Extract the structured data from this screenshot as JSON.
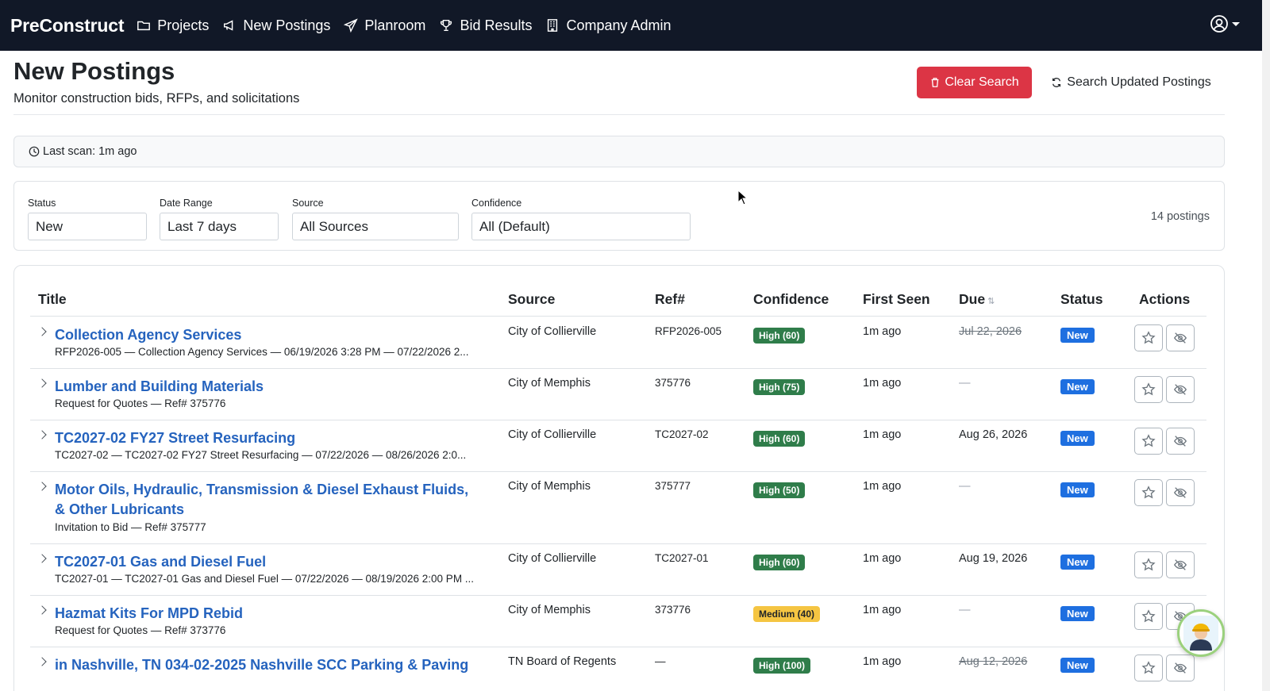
{
  "nav": {
    "brand": "PreConstruct",
    "items": [
      {
        "label": "Projects",
        "icon": "folder-icon"
      },
      {
        "label": "New Postings",
        "icon": "megaphone-icon"
      },
      {
        "label": "Planroom",
        "icon": "paper-plane-icon"
      },
      {
        "label": "Bid Results",
        "icon": "trophy-icon"
      },
      {
        "label": "Company Admin",
        "icon": "building-icon"
      }
    ],
    "user_icon": "user-circle-icon"
  },
  "header": {
    "title": "New Postings",
    "subtitle": "Monitor construction bids, RFPs, and solicitations",
    "clear_label": "Clear Search",
    "search_label": "Search Updated Postings"
  },
  "scan": {
    "text": "Last scan: 1m ago"
  },
  "filters": {
    "status": {
      "label": "Status",
      "value": "New"
    },
    "date_range": {
      "label": "Date Range",
      "value": "Last 7 days"
    },
    "source": {
      "label": "Source",
      "value": "All Sources"
    },
    "confidence": {
      "label": "Confidence",
      "value": "All (Default)"
    },
    "count": "14 postings"
  },
  "table": {
    "columns": {
      "title": "Title",
      "source": "Source",
      "ref": "Ref#",
      "confidence": "Confidence",
      "first_seen": "First Seen",
      "due": "Due",
      "status": "Status",
      "actions": "Actions"
    },
    "rows": [
      {
        "title": "Collection Agency Services",
        "sub": "RFP2026-005 — Collection Agency Services — 06/19/2026 3:28 PM — 07/22/2026 2...",
        "source": "City of Collierville",
        "ref": "RFP2026-005",
        "confidence": "High (60)",
        "level": "high",
        "seen": "1m ago",
        "due": "Jul 22, 2026",
        "due_style": "strike",
        "status": "New"
      },
      {
        "title": "Lumber and Building Materials",
        "sub": "Request for Quotes — Ref# 375776",
        "source": "City of Memphis",
        "ref": "375776",
        "confidence": "High (75)",
        "level": "high",
        "seen": "1m ago",
        "due": "—",
        "due_style": "dash",
        "status": "New"
      },
      {
        "title": "TC2027-02 FY27 Street Resurfacing",
        "sub": "TC2027-02 — TC2027-02 FY27 Street Resurfacing — 07/22/2026 — 08/26/2026 2:0...",
        "source": "City of Collierville",
        "ref": "TC2027-02",
        "confidence": "High (60)",
        "level": "high",
        "seen": "1m ago",
        "due": "Aug 26, 2026",
        "due_style": "normal",
        "status": "New"
      },
      {
        "title": "Motor Oils, Hydraulic, Transmission & Diesel Exhaust Fluids, & Other Lubricants",
        "sub": "Invitation to Bid — Ref# 375777",
        "source": "City of Memphis",
        "ref": "375777",
        "confidence": "High (50)",
        "level": "high",
        "seen": "1m ago",
        "due": "—",
        "due_style": "dash",
        "status": "New"
      },
      {
        "title": "TC2027-01 Gas and Diesel Fuel",
        "sub": "TC2027-01 — TC2027-01 Gas and Diesel Fuel — 07/22/2026 — 08/19/2026 2:00 PM ...",
        "source": "City of Collierville",
        "ref": "TC2027-01",
        "confidence": "High (60)",
        "level": "high",
        "seen": "1m ago",
        "due": "Aug 19, 2026",
        "due_style": "normal",
        "status": "New"
      },
      {
        "title": "Hazmat Kits For MPD Rebid",
        "sub": "Request for Quotes — Ref# 373776",
        "source": "City of Memphis",
        "ref": "373776",
        "confidence": "Medium (40)",
        "level": "medium",
        "seen": "1m ago",
        "due": "—",
        "due_style": "dash",
        "status": "New"
      },
      {
        "title": "in Nashville, TN 034-02-2025 Nashville SCC Parking & Paving",
        "sub": "",
        "source": "TN Board of Regents",
        "ref": "—",
        "confidence": "High (100)",
        "level": "high",
        "seen": "1m ago",
        "due": "Aug 12, 2026",
        "due_style": "strike",
        "status": "New"
      }
    ]
  },
  "colors": {
    "navbar": "#111827",
    "link": "#2563be",
    "danger": "#dc3545",
    "status_new": "#1e6fe0",
    "confidence_high": "#2f7d4a",
    "confidence_medium": "#f5c542"
  }
}
